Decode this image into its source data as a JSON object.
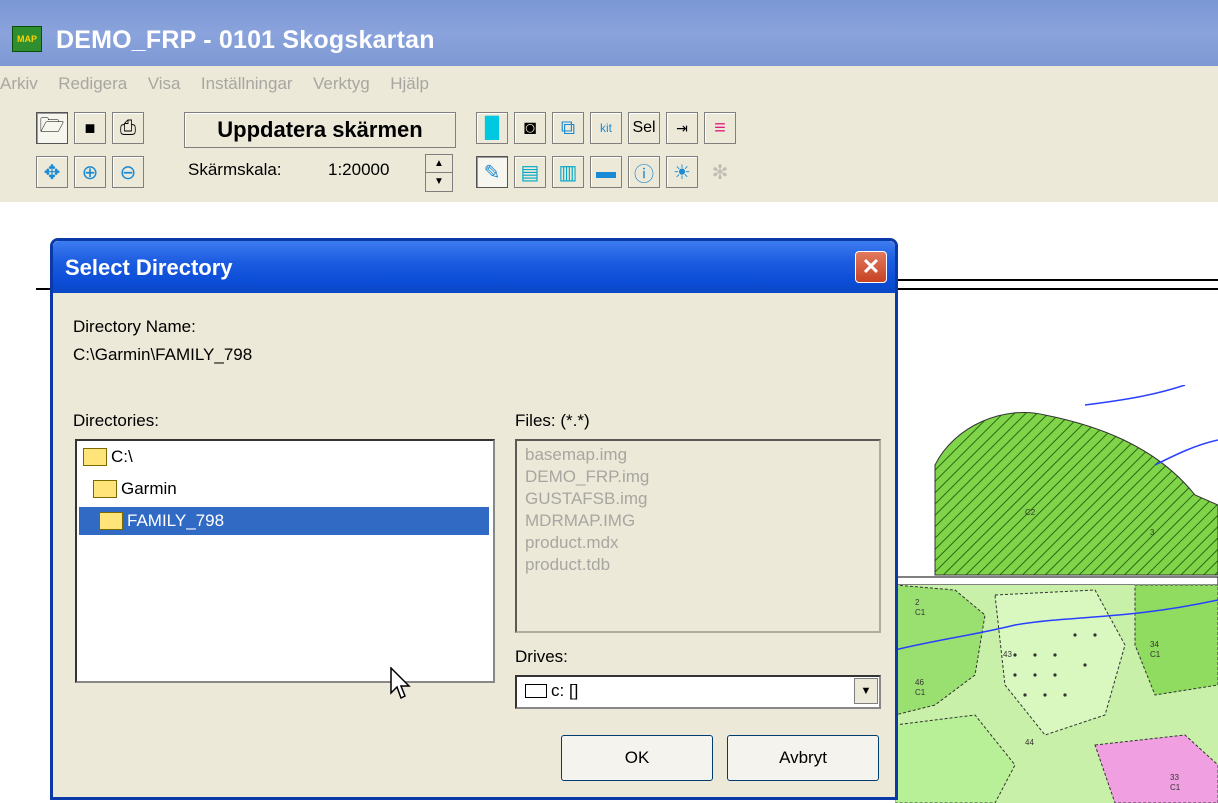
{
  "window": {
    "title": "DEMO_FRP - 0101 Skogskartan",
    "icon_label": "MAP"
  },
  "menu": [
    "Arkiv",
    "Redigera",
    "Visa",
    "Inställningar",
    "Verktyg",
    "Hjälp"
  ],
  "toolbar": {
    "update_label": "Uppdatera skärmen",
    "scale_label": "Skärmskala:",
    "scale_value": "1:20000",
    "sel_label": "Sel"
  },
  "dialog": {
    "title": "Select Directory",
    "directory_name_label": "Directory Name:",
    "directory_path": "C:\\Garmin\\FAMILY_798",
    "directories_label": "Directories:",
    "directories": [
      "C:\\",
      "Garmin",
      "FAMILY_798"
    ],
    "selected_directory": "FAMILY_798",
    "files_label": "Files: (*.*)",
    "files": [
      "basemap.img",
      "DEMO_FRP.img",
      "GUSTAFSB.img",
      "MDRMAP.IMG",
      "product.mdx",
      "product.tdb"
    ],
    "drives_label": "Drives:",
    "drive_value": "c: []",
    "ok_label": "OK",
    "cancel_label": "Avbryt"
  },
  "map": {
    "labels": [
      "C2",
      "2",
      "C1",
      "3",
      "34",
      "C1",
      "46",
      "C1",
      "33",
      "C1",
      "43",
      "44"
    ]
  },
  "colors": {
    "title_bar": "#8aa3dc",
    "dialog_title": "#1c5ce0",
    "selection": "#316ac5",
    "chrome": "#ece9d8",
    "map_green": "#7fd44a",
    "map_light_green": "#c8f0a8"
  }
}
